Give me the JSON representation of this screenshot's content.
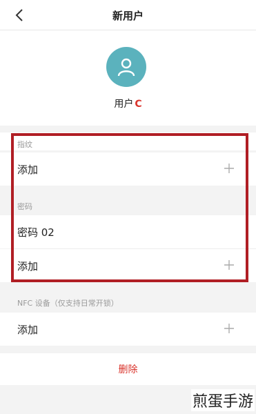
{
  "nav": {
    "title": "新用户"
  },
  "user": {
    "name": "用户",
    "badge": "C"
  },
  "fingerprint": {
    "label": "指纹",
    "add_label": "添加"
  },
  "password": {
    "label": "密码",
    "item": "密码 02",
    "add_label": "添加"
  },
  "nfc": {
    "label": "NFC 设备（仅支持日常开锁）",
    "add_label": "添加"
  },
  "actions": {
    "delete_label": "删除"
  },
  "watermark": "煎蛋手游",
  "colors": {
    "avatar": "#5bb2bd",
    "danger": "#d9332b",
    "highlight": "#b01e24"
  }
}
